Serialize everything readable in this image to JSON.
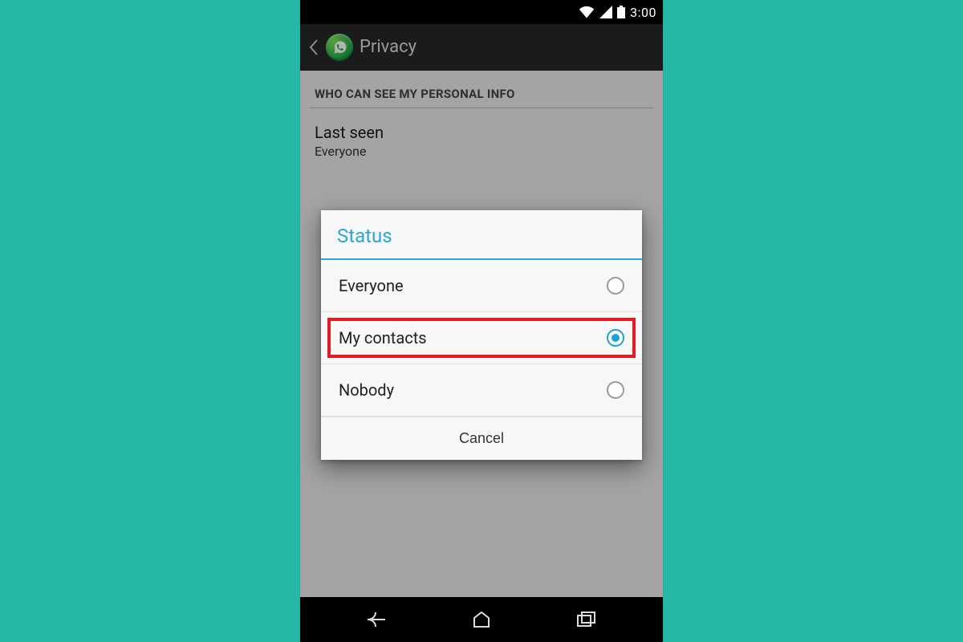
{
  "statusbar": {
    "time": "3:00"
  },
  "actionbar": {
    "title": "Privacy"
  },
  "settings": {
    "section_header": "WHO CAN SEE MY PERSONAL INFO",
    "rows": [
      {
        "title": "Last seen",
        "subtitle": "Everyone"
      }
    ]
  },
  "dialog": {
    "title": "Status",
    "options": [
      {
        "label": "Everyone",
        "selected": false,
        "highlighted": false
      },
      {
        "label": "My contacts",
        "selected": true,
        "highlighted": true
      },
      {
        "label": "Nobody",
        "selected": false,
        "highlighted": false
      }
    ],
    "cancel_label": "Cancel"
  }
}
